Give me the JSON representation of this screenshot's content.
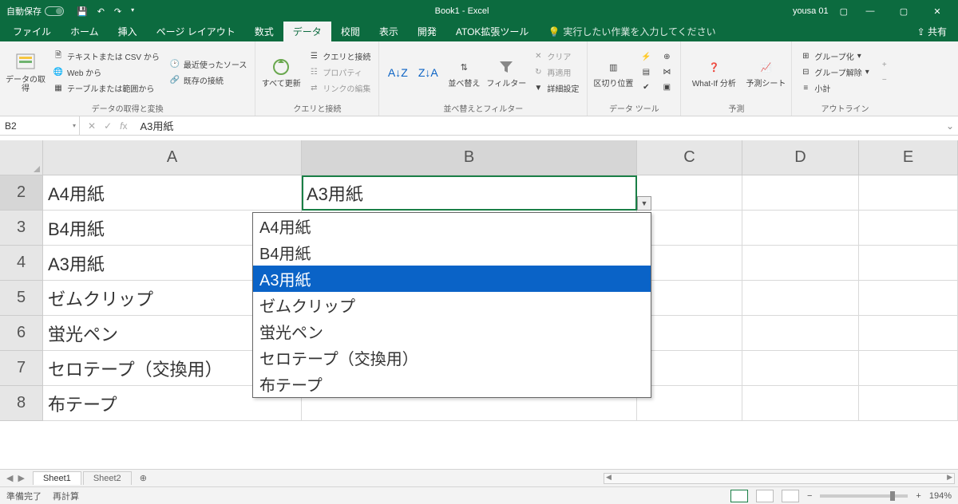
{
  "titlebar": {
    "autosave_label": "自動保存",
    "autosave_state": "オフ",
    "title": "Book1  -  Excel",
    "user": "yousa 01"
  },
  "tabs": {
    "file": "ファイル",
    "home": "ホーム",
    "insert": "挿入",
    "layout": "ページ レイアウト",
    "formula": "数式",
    "data": "データ",
    "review": "校閲",
    "view": "表示",
    "dev": "開発",
    "atok": "ATOK拡張ツール",
    "tellme": "実行したい作業を入力してください",
    "share": "共有"
  },
  "ribbon": {
    "group1_label": "データの取得と変換",
    "get_data": "データの取得",
    "text_csv": "テキストまたは CSV から",
    "web": "Web から",
    "table_range": "テーブルまたは範囲から",
    "recent": "最近使ったソース",
    "existing": "既存の接続",
    "group2_label": "クエリと接続",
    "refresh_all": "すべて更新",
    "queries": "クエリと接続",
    "properties": "プロパティ",
    "edit_links": "リンクの編集",
    "group3_label": "並べ替えとフィルター",
    "sort": "並べ替え",
    "filter": "フィルター",
    "clear": "クリア",
    "reapply": "再適用",
    "advanced": "詳細設定",
    "group4_label": "データ ツール",
    "text_to_col": "区切り位置",
    "group5_label": "予測",
    "what_if": "What-If 分析",
    "forecast": "予測シート",
    "group6_label": "アウトライン",
    "group": "グループ化",
    "ungroup": "グループ解除",
    "subtotal": "小計"
  },
  "formula_bar": {
    "namebox": "B2",
    "content": "A3用紙"
  },
  "columns": [
    "A",
    "B",
    "C",
    "D",
    "E"
  ],
  "rows": [
    "2",
    "3",
    "4",
    "5",
    "6",
    "7",
    "8"
  ],
  "cells": {
    "A2": "A4用紙",
    "A3": "B4用紙",
    "A4": "A3用紙",
    "A5": "ゼムクリップ",
    "A6": "蛍光ペン",
    "A7": "セロテープ（交換用）",
    "A8": "布テープ",
    "B2": "A3用紙"
  },
  "dropdown": {
    "items": [
      "A4用紙",
      "B4用紙",
      "A3用紙",
      "ゼムクリップ",
      "蛍光ペン",
      "セロテープ（交換用）",
      "布テープ"
    ],
    "highlighted_index": 2
  },
  "sheets": {
    "active": "Sheet1",
    "other": "Sheet2"
  },
  "status": {
    "ready": "準備完了",
    "recalc": "再計算",
    "zoom": "194%"
  }
}
